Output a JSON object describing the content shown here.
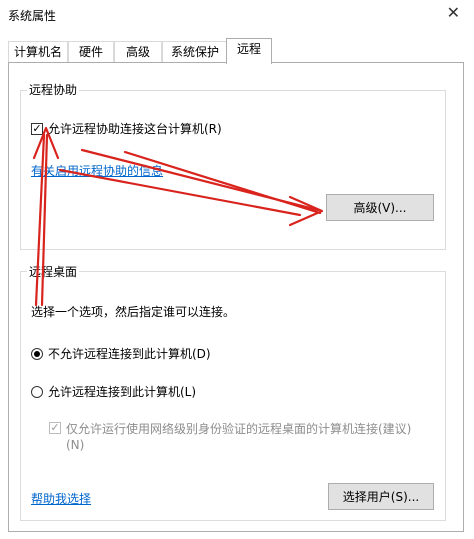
{
  "window": {
    "title": "系统属性",
    "close_glyph": "✕"
  },
  "tabs": [
    {
      "label": "计算机名"
    },
    {
      "label": "硬件"
    },
    {
      "label": "高级"
    },
    {
      "label": "系统保护"
    },
    {
      "label": "远程"
    }
  ],
  "active_tab": "远程",
  "remote_assistance": {
    "legend": "远程协助",
    "checkbox_label": "允许远程协助连接这台计算机(R)",
    "checkbox_checked": true,
    "info_link": "有关启用远程协助的信息",
    "advanced_button": "高级(V)..."
  },
  "remote_desktop": {
    "legend": "远程桌面",
    "instruction": "选择一个选项，然后指定谁可以连接。",
    "option_disallow": "不允许远程连接到此计算机(D)",
    "option_allow": "允许远程连接到此计算机(L)",
    "selected_option": "不允许远程连接到此计算机(D)",
    "nla_line1": "仅允许运行使用网络级别身份验证的远程桌面的计算机连接(建议)",
    "nla_line2": "(N)",
    "nla_checked": true,
    "help_link": "帮助我选择",
    "select_users_button": "选择用户(S)..."
  },
  "annotation_color": "#d9231d",
  "colors": {
    "link": "#0066cc",
    "button_bg": "#e1e1e1",
    "border": "#adadad"
  }
}
